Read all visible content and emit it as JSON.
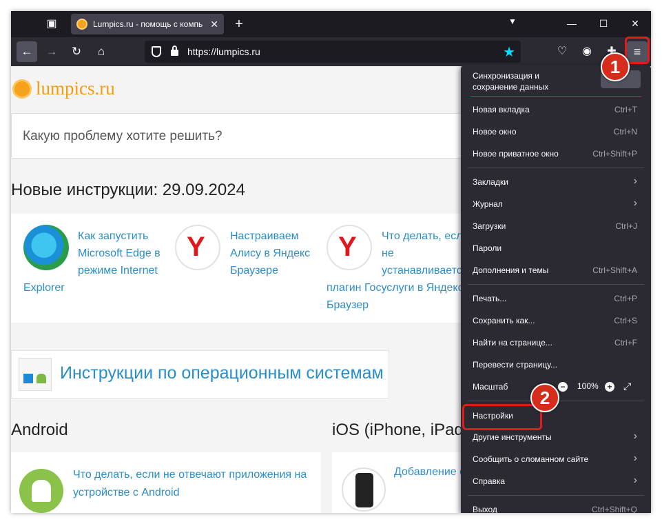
{
  "browser": {
    "tab_title": "Lumpics.ru - помощь с компь",
    "url": "https://lumpics.ru"
  },
  "page": {
    "logo": "lumpics.ru",
    "search_placeholder": "Какую проблему хотите решить?",
    "new_heading": "Новые инструкции: 29.09.2024",
    "cards": [
      {
        "title_lines": [
          "Как запустить",
          "Microsoft Edge в",
          "режиме Internet"
        ],
        "tail": "Explorer"
      },
      {
        "title_lines": [
          "Настраиваем",
          "Алису в Яндекс",
          "Браузере"
        ]
      },
      {
        "title_lines": [
          "Что делать, если",
          "не",
          "устанавливается"
        ],
        "tail_lines": [
          "плагин Госуслуги в Яндекс",
          "Браузер"
        ]
      }
    ],
    "os_title": "Инструкции по операционным системам",
    "android_heading": "Android",
    "ios_heading": "iOS (iPhone, iPad)",
    "android_card_text": "Что делать, если не отвечают приложения на устройстве с Android",
    "ios_card_text": "Добавление с"
  },
  "menu": {
    "sync_text": "Синхронизация и сохранение данных",
    "items": [
      {
        "label": "Новая вкладка",
        "shortcut": "Ctrl+T"
      },
      {
        "label": "Новое окно",
        "shortcut": "Ctrl+N"
      },
      {
        "label": "Новое приватное окно",
        "shortcut": "Ctrl+Shift+P"
      },
      {
        "label": "Закладки"
      },
      {
        "label": "Журнал"
      },
      {
        "label": "Загрузки",
        "shortcut": "Ctrl+J"
      },
      {
        "label": "Пароли"
      },
      {
        "label": "Дополнения и темы",
        "shortcut": "Ctrl+Shift+A"
      },
      {
        "label": "Печать...",
        "shortcut": "Ctrl+P"
      },
      {
        "label": "Сохранить как...",
        "shortcut": "Ctrl+S"
      },
      {
        "label": "Найти на странице...",
        "shortcut": "Ctrl+F"
      },
      {
        "label": "Перевести страницу..."
      },
      {
        "label": "Масштаб",
        "zoom": "100%"
      },
      {
        "label": "Настройки"
      },
      {
        "label": "Другие инструменты"
      },
      {
        "label": "Сообщить о сломанном сайте"
      },
      {
        "label": "Справка"
      },
      {
        "label": "Выход",
        "shortcut": "Ctrl+Shift+Q"
      }
    ]
  },
  "annotations": {
    "step1": "1",
    "step2": "2",
    "color": "#d52c1c"
  },
  "icons": [
    "tab-list-icon",
    "favicon-icon",
    "close-icon",
    "plus-icon",
    "chevron-down-icon",
    "minimize-icon",
    "maximize-icon",
    "window-close-icon",
    "back-arrow-icon",
    "forward-arrow-icon",
    "reload-icon",
    "home-icon",
    "shield-icon",
    "lock-icon",
    "star-icon",
    "pocket-icon",
    "account-icon",
    "extensions-icon",
    "hamburger-menu-icon"
  ]
}
